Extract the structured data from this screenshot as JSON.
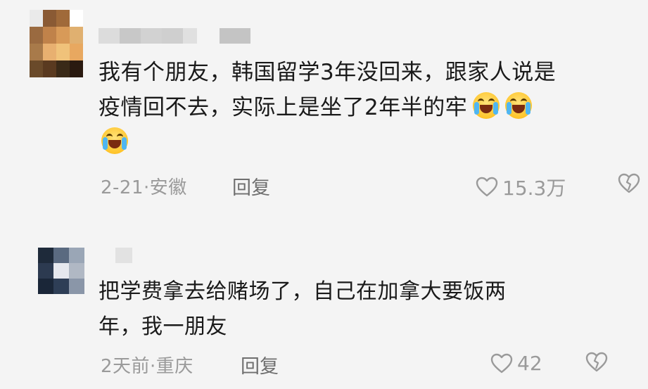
{
  "comments": [
    {
      "text_line1": "我有个朋友，韩国留学3年没回来，跟家人说是",
      "text_line2": "疫情回不去，实际上是坐了2年半的牢",
      "emoji": "crying-laughing-emoji",
      "meta": "2-21·安徽",
      "reply_label": "回复",
      "like_count": "15.3万",
      "avatar_colors": [
        "#eaeaea",
        "#8a5a34",
        "#a06a3a",
        "#ffffff",
        "#9a6a40",
        "#c0824a",
        "#d89a58",
        "#e0b070",
        "#a87a4a",
        "#e8b070",
        "#f0c27a",
        "#e8a860",
        "#6a4a2a",
        "#5a3a20",
        "#3a2a18",
        "#2a1a10"
      ]
    },
    {
      "text_line1": "把学费拿去给赌场了，自己在加拿大要饭两",
      "text_line2": "年，我一朋友",
      "meta": "2天前·重庆",
      "reply_label": "回复",
      "like_count": "42",
      "avatar_colors": [
        "#1e2a3a",
        "#5a6a80",
        "#9aa6b6",
        "#2c3a50",
        "#e6e8ee",
        "#b0b8c4",
        "#1a2638",
        "#2e3e56",
        "#8a96a8"
      ]
    }
  ],
  "icons": {
    "like": "heart-outline-icon",
    "dislike": "broken-heart-icon"
  }
}
